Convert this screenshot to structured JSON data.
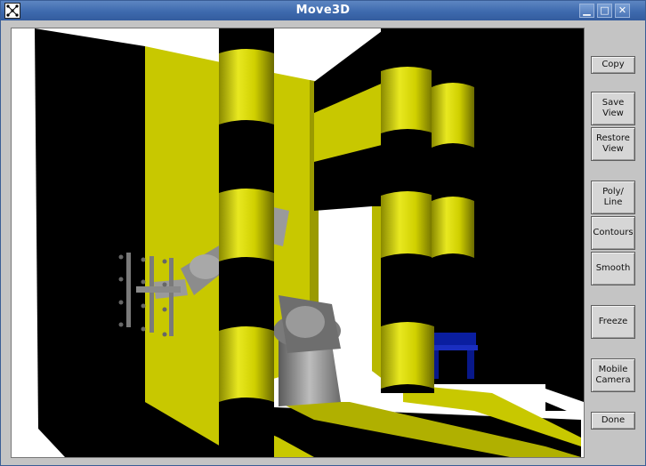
{
  "window": {
    "title": "Move3D"
  },
  "controls": {
    "minimize": "▁",
    "maximize": "□",
    "close": "✕"
  },
  "buttons": {
    "copy": "Copy",
    "save_view": "Save\nView",
    "restore_view": "Restore\nView",
    "poly_line": "Poly/\nLine",
    "contours": "Contours",
    "smooth": "Smooth",
    "freeze": "Freeze",
    "mobile_camera": "Mobile\nCamera",
    "done": "Done"
  },
  "colors": {
    "yellow": "#c8c800",
    "black": "#000000",
    "gray_robot": "#8c8c8c",
    "blue_table": "#0a1ea0",
    "titlebar": "#3e6aae"
  },
  "icons": {
    "app": "move3d-logo-icon",
    "minimize": "minimize-icon",
    "maximize": "maximize-icon",
    "close": "close-icon"
  }
}
